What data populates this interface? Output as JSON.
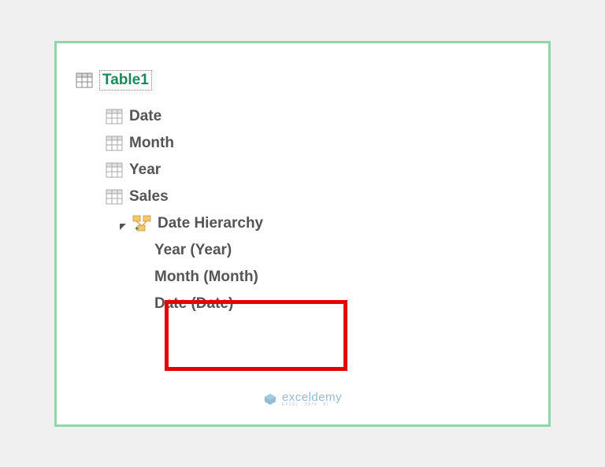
{
  "tree": {
    "root": "Table1",
    "columns": {
      "col1": "Date",
      "col2": "Month",
      "col3": "Year",
      "col4": "Sales"
    },
    "hierarchy": {
      "name": "Date Hierarchy",
      "levels": {
        "level1": "Year (Year)",
        "level2": "Month (Month)",
        "level3": "Date (Date)"
      }
    }
  },
  "watermark": {
    "main": "exceldemy",
    "sub": "EXCEL · DATA · BI"
  }
}
